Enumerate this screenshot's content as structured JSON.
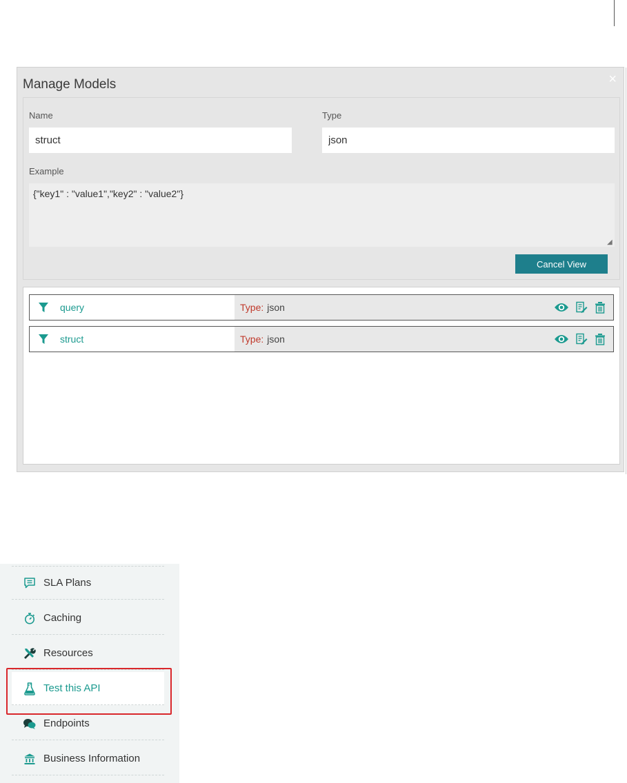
{
  "modal": {
    "title": "Manage Models",
    "close_glyph": "×",
    "form": {
      "name_label": "Name",
      "name_value": "struct",
      "type_label": "Type",
      "type_value": "json",
      "example_label": "Example",
      "example_value": "{\"key1\" : \"value1\",\"key2\" : \"value2\"}",
      "cancel_label": "Cancel View"
    },
    "models": [
      {
        "name": "query",
        "type_label": "Type:",
        "type_value": "json"
      },
      {
        "name": "struct",
        "type_label": "Type:",
        "type_value": "json"
      }
    ]
  },
  "nav": {
    "items": [
      {
        "label": "SLA Plans",
        "icon": "sla-plans-icon"
      },
      {
        "label": "Caching",
        "icon": "stopwatch-icon"
      },
      {
        "label": "Resources",
        "icon": "tools-icon"
      },
      {
        "label": "Test this API",
        "icon": "flask-icon",
        "active": true
      },
      {
        "label": "Endpoints",
        "icon": "endpoints-icon"
      },
      {
        "label": "Business Information",
        "icon": "bank-icon"
      }
    ]
  },
  "colors": {
    "accent": "#1b9a8f",
    "button": "#1e7f8c",
    "type_label": "#c0392b",
    "highlight": "#d9262a"
  }
}
